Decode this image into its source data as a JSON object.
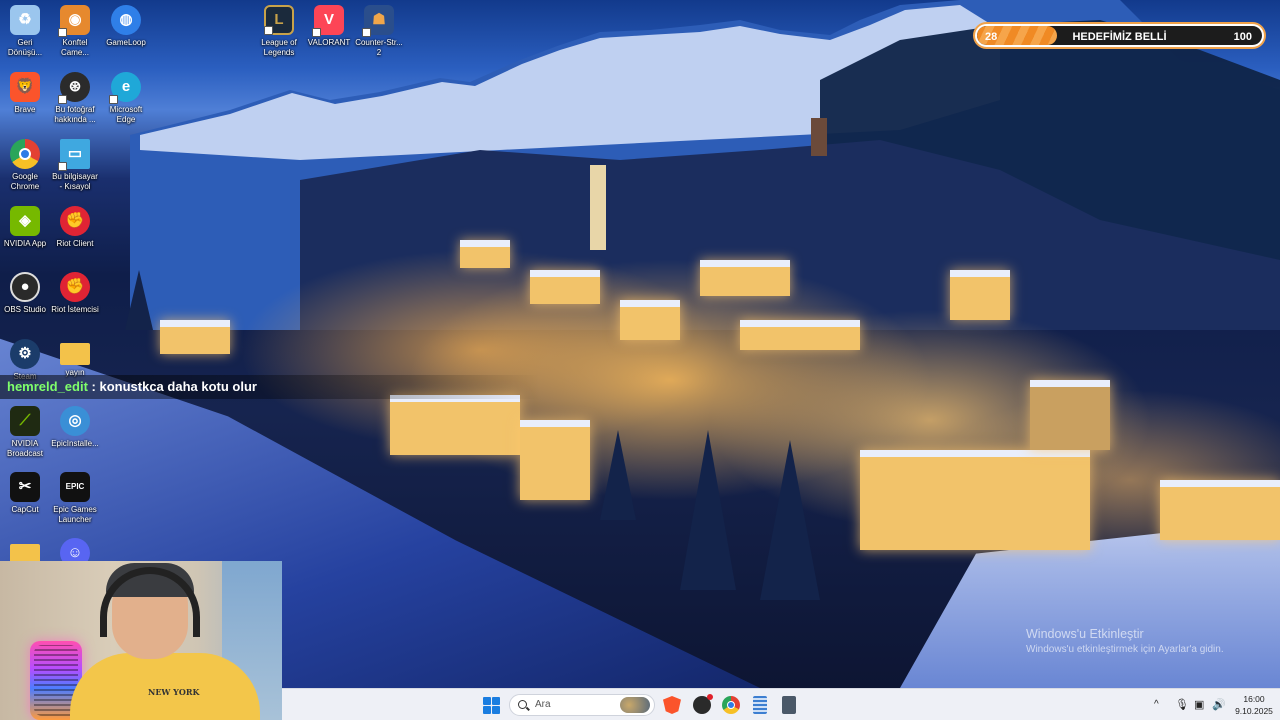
{
  "desktop_icons": [
    {
      "id": "recycle-bin",
      "label": "Geri Dönüşü...",
      "icon": "recycle-bin-icon",
      "color": "#9bc6ee"
    },
    {
      "id": "konftel",
      "label": "Konftel Came...",
      "icon": "konftel-camera-icon",
      "color": "#e6892e"
    },
    {
      "id": "gameloop",
      "label": "GameLoop",
      "icon": "gameloop-icon",
      "color": "#2f7fe8"
    },
    {
      "id": "brave",
      "label": "Brave",
      "icon": "brave-icon",
      "color": "#fb542b"
    },
    {
      "id": "about-photo",
      "label": "Bu fotoğraf hakkında ...",
      "icon": "aperture-icon",
      "color": "#2b2b2b"
    },
    {
      "id": "edge",
      "label": "Microsoft Edge",
      "icon": "edge-icon",
      "color": "#1fa8d8"
    },
    {
      "id": "chrome",
      "label": "Google Chrome",
      "icon": "chrome-icon",
      "color": "#e34133"
    },
    {
      "id": "this-pc",
      "label": "Bu bilgisayar - Kısayol",
      "icon": "monitor-icon",
      "color": "#3fa8e0"
    },
    {
      "id": "nvidia-app",
      "label": "NVIDIA App",
      "icon": "nvidia-icon",
      "color": "#76b900"
    },
    {
      "id": "riot-client",
      "label": "Riot Client",
      "icon": "riot-icon",
      "color": "#e02434"
    },
    {
      "id": "obs",
      "label": "OBS Studio",
      "icon": "obs-icon",
      "color": "#2a2a2a"
    },
    {
      "id": "riot-istemci",
      "label": "Riot İstemcisi",
      "icon": "riot-icon",
      "color": "#e02434"
    },
    {
      "id": "steam",
      "label": "Steam",
      "icon": "steam-icon",
      "color": "#1b3c6a"
    },
    {
      "id": "yayin",
      "label": "yayın",
      "icon": "folder-icon",
      "color": "#f3c24a"
    },
    {
      "id": "nvidia-broadcast",
      "label": "NVIDIA Broadcast",
      "icon": "nvidia-broadcast-icon",
      "color": "#1f2a12"
    },
    {
      "id": "epic-installer",
      "label": "EpicInstalle...",
      "icon": "installer-disc-icon",
      "color": "#3a8fd6"
    },
    {
      "id": "capcut",
      "label": "CapCut",
      "icon": "capcut-icon",
      "color": "#111111"
    },
    {
      "id": "epic-launcher",
      "label": "Epic Games Launcher",
      "icon": "epic-games-icon",
      "color": "#111111"
    },
    {
      "id": "folder-2",
      "label": "",
      "icon": "folder-icon",
      "color": "#f3c24a"
    },
    {
      "id": "discord",
      "label": "",
      "icon": "discord-icon",
      "color": "#5865f2"
    },
    {
      "id": "lol",
      "label": "League of Legends",
      "icon": "league-icon",
      "color": "#1b2a3c"
    },
    {
      "id": "valorant",
      "label": "VALORANT",
      "icon": "valorant-icon",
      "color": "#fd4556"
    },
    {
      "id": "cs2",
      "label": "Counter-Str... 2",
      "icon": "counter-strike-icon",
      "color": "#2a4e8c"
    }
  ],
  "goal_widget": {
    "current": "28",
    "label": "HEDEFİMİZ BELLİ",
    "max": "100",
    "progress": 0.28,
    "fill_color": "#f08a24"
  },
  "chat": {
    "username": "hemreld_edit",
    "separator": " : ",
    "message": "konustkca daha kotu olur"
  },
  "webcam": {
    "shirt_text": "NEW YORK"
  },
  "watermark": {
    "title": "Windows'u Etkinleştir",
    "subtitle": "Windows'u etkinleştirmek için Ayarlar'a gidin."
  },
  "taskbar": {
    "search_placeholder": "Ara",
    "apps": [
      {
        "id": "brave",
        "icon": "brave-icon",
        "color": "#fb542b"
      },
      {
        "id": "obs",
        "icon": "obs-icon",
        "color": "#2a2a2a"
      },
      {
        "id": "chrome",
        "icon": "chrome-icon",
        "color": "#e34133"
      },
      {
        "id": "notepad",
        "icon": "notepad-icon",
        "color": "#3d7fd1"
      },
      {
        "id": "calculator",
        "icon": "calculator-icon",
        "color": "#4a5868"
      }
    ],
    "tray": {
      "chevron": "^",
      "time": "16:00",
      "date": "9.10.2025"
    }
  }
}
